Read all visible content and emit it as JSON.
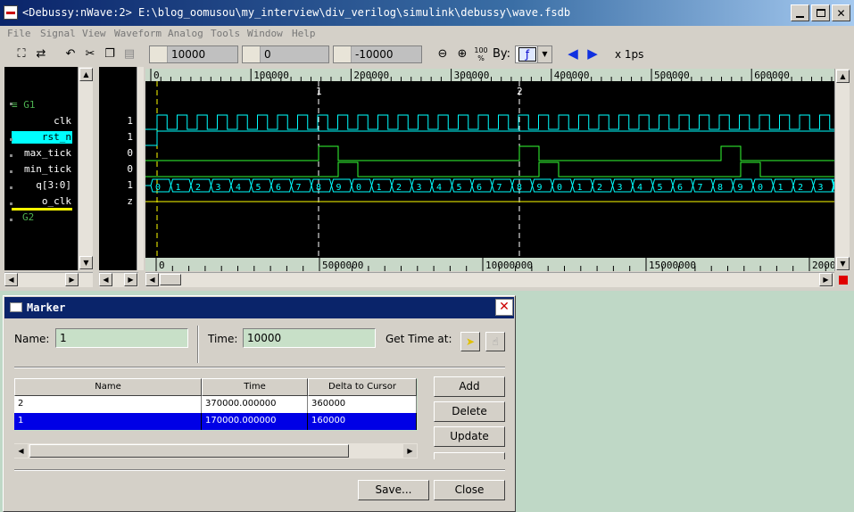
{
  "window": {
    "title": "<Debussy:nWave:2> E:\\blog_oomusou\\my_interview\\div_verilog\\simulink\\debussy\\wave.fsdb"
  },
  "menu": [
    "File",
    "Signal",
    "View",
    "Waveform",
    "Analog",
    "Tools",
    "Window",
    "Help"
  ],
  "toolbar": {
    "cursor_time": "10000",
    "marker_time": "0",
    "delta_time": "-10000",
    "zoom_fit_label": "100 %",
    "by_label": "By:",
    "time_unit": "x 1ps"
  },
  "signals": {
    "groups": [
      "G1",
      "G2"
    ],
    "names": [
      "clk",
      "rst_n",
      "max_tick",
      "min_tick",
      "q[3:0]",
      "o_clk"
    ],
    "values": [
      "1",
      "1",
      "0",
      "0",
      "1",
      "z"
    ]
  },
  "waveform": {
    "top_ruler_labels": [
      "0",
      "100000",
      "200000",
      "300000",
      "400000",
      "500000",
      "600000"
    ],
    "marker_labels": [
      "1",
      "2"
    ],
    "bottom_ruler_labels": [
      "0",
      "5000000",
      "10000000",
      "15000000",
      "2000"
    ],
    "bus_values": [
      "0",
      "1",
      "2",
      "3",
      "4",
      "5",
      "6",
      "7",
      "8",
      "9",
      "0",
      "1",
      "2",
      "3",
      "4",
      "5",
      "6",
      "7",
      "8",
      "9",
      "0",
      "1",
      "2",
      "3",
      "4",
      "5",
      "6",
      "7",
      "8",
      "9",
      "0",
      "1",
      "2",
      "3",
      "4"
    ],
    "colors": {
      "background": "#000000",
      "clk": "#00ffff",
      "tick": "#33ff33",
      "bus": "#00ffff",
      "o_clk": "#ffff00",
      "cursor": "#ffff00",
      "marker": "#ffffff",
      "selected_signal": "#00ffff"
    }
  },
  "marker_dialog": {
    "title": "Marker",
    "name_label": "Name:",
    "name_value": "1",
    "time_label": "Time:",
    "time_value": "10000",
    "get_time_label": "Get Time at:",
    "columns": [
      "Name",
      "Time",
      "Delta to Cursor"
    ],
    "rows": [
      {
        "name": "2",
        "time": "370000.000000",
        "delta": "360000"
      },
      {
        "name": "1",
        "time": "170000.000000",
        "delta": "160000"
      }
    ],
    "buttons": {
      "add": "Add",
      "delete": "Delete",
      "update": "Update",
      "save": "Save...",
      "close": "Close"
    }
  }
}
